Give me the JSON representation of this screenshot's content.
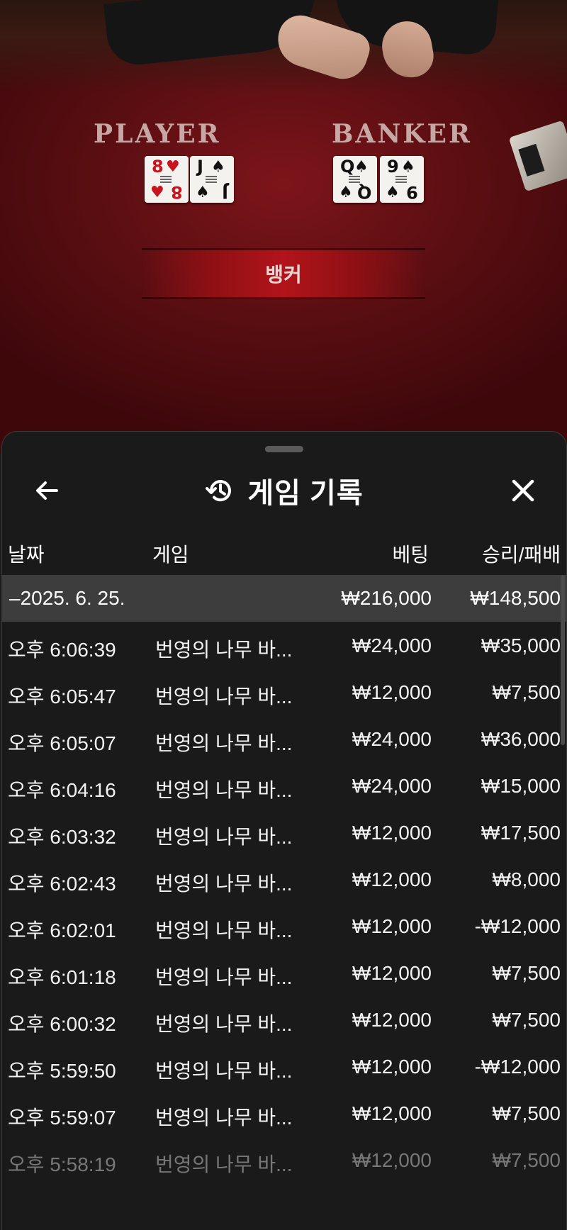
{
  "table": {
    "player_label": "PLAYER",
    "banker_label": "BANKER",
    "result_label": "뱅커",
    "player_cards": [
      {
        "rank": "8",
        "suit": "♥",
        "color": "red"
      },
      {
        "rank": "J",
        "suit": "♠",
        "color": "black"
      }
    ],
    "banker_cards": [
      {
        "rank": "Q",
        "suit": "♠",
        "color": "black"
      },
      {
        "rank": "9",
        "suit": "♠",
        "color": "black"
      }
    ]
  },
  "sheet": {
    "title": "게임 기록",
    "icons": {
      "back": "arrow-left-icon",
      "history": "history-icon",
      "close": "close-icon"
    },
    "columns": {
      "date": "날짜",
      "game": "게임",
      "bet": "베팅",
      "win_loss": "승리/패배"
    },
    "summary": {
      "date": "–2025. 6. 25.",
      "bet": "₩216,000",
      "win_loss": "₩148,500"
    },
    "rows": [
      {
        "time": "오후 6:06:39",
        "game": "번영의 나무 바...",
        "bet": "₩24,000",
        "win_loss": "₩35,000"
      },
      {
        "time": "오후 6:05:47",
        "game": "번영의 나무 바...",
        "bet": "₩12,000",
        "win_loss": "₩7,500"
      },
      {
        "time": "오후 6:05:07",
        "game": "번영의 나무 바...",
        "bet": "₩24,000",
        "win_loss": "₩36,000"
      },
      {
        "time": "오후 6:04:16",
        "game": "번영의 나무 바...",
        "bet": "₩24,000",
        "win_loss": "₩15,000"
      },
      {
        "time": "오후 6:03:32",
        "game": "번영의 나무 바...",
        "bet": "₩12,000",
        "win_loss": "₩17,500"
      },
      {
        "time": "오후 6:02:43",
        "game": "번영의 나무 바...",
        "bet": "₩12,000",
        "win_loss": "₩8,000"
      },
      {
        "time": "오후 6:02:01",
        "game": "번영의 나무 바...",
        "bet": "₩12,000",
        "win_loss": "-₩12,000"
      },
      {
        "time": "오후 6:01:18",
        "game": "번영의 나무 바...",
        "bet": "₩12,000",
        "win_loss": "₩7,500"
      },
      {
        "time": "오후 6:00:32",
        "game": "번영의 나무 바...",
        "bet": "₩12,000",
        "win_loss": "₩7,500"
      },
      {
        "time": "오후 5:59:50",
        "game": "번영의 나무 바...",
        "bet": "₩12,000",
        "win_loss": "-₩12,000"
      },
      {
        "time": "오후 5:59:07",
        "game": "번영의 나무 바...",
        "bet": "₩12,000",
        "win_loss": "₩7,500"
      },
      {
        "time": "오후 5:58:19",
        "game": "번영의 나무 바...",
        "bet": "₩12,000",
        "win_loss": "₩7,500"
      }
    ]
  }
}
